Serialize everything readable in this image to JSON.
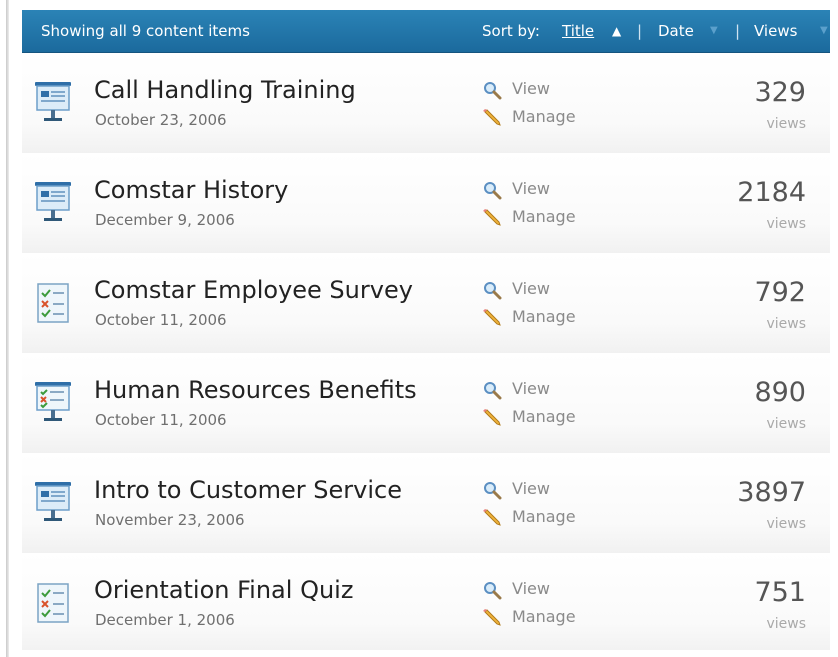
{
  "header": {
    "showing_text": "Showing all 9 content items",
    "sort_label": "Sort by:",
    "sort_title": "Title",
    "sort_title_arrow": "▲",
    "separator": "|",
    "sort_date": "Date",
    "sort_views": "Views",
    "inactive_arrow": "▼"
  },
  "colors": {
    "header_background": "#1f75aa",
    "title_text": "#222222",
    "secondary_text": "#6f6f6f"
  },
  "items": [
    {
      "icon": "presentation-icon",
      "title": "Call Handling Training",
      "date": "October 23, 2006",
      "view_label": "View",
      "manage_label": "Manage",
      "views": "329",
      "views_label": "views"
    },
    {
      "icon": "presentation-icon",
      "title": "Comstar History",
      "date": "December 9, 2006",
      "view_label": "View",
      "manage_label": "Manage",
      "views": "2184",
      "views_label": "views"
    },
    {
      "icon": "survey-checklist-icon",
      "title": "Comstar Employee Survey",
      "date": "October 11, 2006",
      "view_label": "View",
      "manage_label": "Manage",
      "views": "792",
      "views_label": "views"
    },
    {
      "icon": "presentation-quiz-icon",
      "title": "Human Resources Benefits",
      "date": "October 11, 2006",
      "view_label": "View",
      "manage_label": "Manage",
      "views": "890",
      "views_label": "views"
    },
    {
      "icon": "presentation-icon",
      "title": "Intro to Customer Service",
      "date": "November 23, 2006",
      "view_label": "View",
      "manage_label": "Manage",
      "views": "3897",
      "views_label": "views"
    },
    {
      "icon": "survey-checklist-icon",
      "title": "Orientation Final Quiz",
      "date": "December 1, 2006",
      "view_label": "View",
      "manage_label": "Manage",
      "views": "751",
      "views_label": "views"
    }
  ]
}
